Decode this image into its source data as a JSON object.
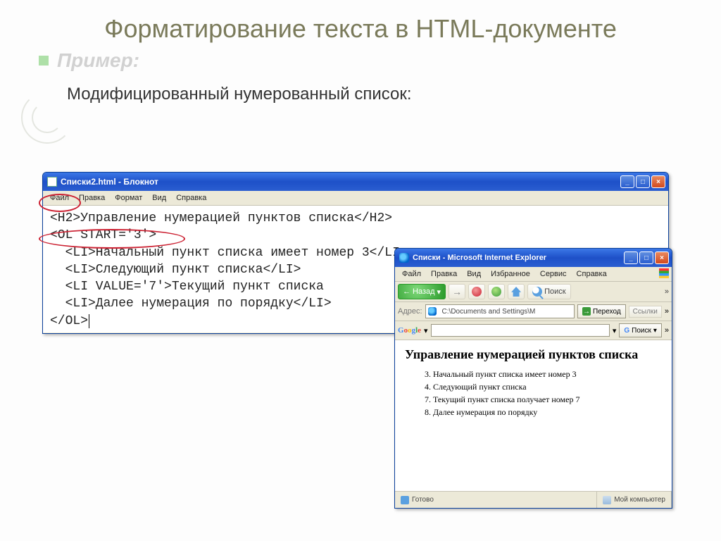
{
  "slide": {
    "title": "Форматирование текста в HTML-документе",
    "example_label": "Пример:",
    "subtitle": "Модифицированный нумерованный список:"
  },
  "notepad": {
    "window_title": "Списки2.html - Блокнот",
    "menu": {
      "file": "Файл",
      "edit": "Правка",
      "format": "Формат",
      "view": "Вид",
      "help": "Справка"
    },
    "code": {
      "l1": "<H2>Управление нумерацией пунктов списка</H2>",
      "l2": "<OL START='3'>",
      "l3": "  <LI>Начальный пункт списка имеет номер 3</LI>",
      "l4": "  <LI>Следующий пункт списка</LI>",
      "l5": "  <LI VALUE='7'>Текущий пункт списка",
      "l6": "  <LI>Далее нумерация по порядку</LI>",
      "l7": "</OL>"
    },
    "btn_min": "_",
    "btn_max": "□",
    "btn_close": "×"
  },
  "ie": {
    "window_title": "Списки - Microsoft Internet Explorer",
    "menu": {
      "file": "Файл",
      "edit": "Правка",
      "view": "Вид",
      "fav": "Избранное",
      "tools": "Сервис",
      "help": "Справка"
    },
    "nav": {
      "back": "Назад",
      "search": "Поиск",
      "more": "»"
    },
    "addr": {
      "label": "Адрес:",
      "value": "C:\\Documents and Settings\\М",
      "go": "Переход",
      "links": "Ссылки"
    },
    "google": {
      "search_label": "Поиск",
      "more": "»",
      "dropdown": "▾"
    },
    "content": {
      "heading": "Управление нумерацией пунктов списка",
      "items": {
        "i3": "Начальный пункт списка имеет номер 3",
        "i4": "Следующий пункт списка",
        "i7": "Текущий пункт списка получает номер 7",
        "i8": "Далее нумерация по порядку"
      }
    },
    "status": {
      "ready": "Готово",
      "zone": "Мой компьютер"
    },
    "btn_min": "_",
    "btn_max": "□",
    "btn_close": "×"
  }
}
